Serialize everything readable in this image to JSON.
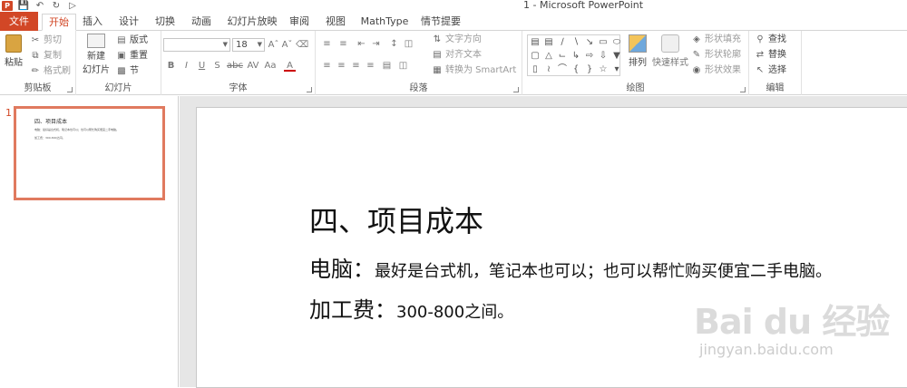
{
  "window_title": "1 - Microsoft PowerPoint",
  "qat": [
    "ppt-logo-icon",
    "save-icon",
    "undo-icon",
    "redo-icon",
    "start-presentation-icon"
  ],
  "tabs": [
    {
      "label": "文件"
    },
    {
      "label": "开始"
    },
    {
      "label": "插入"
    },
    {
      "label": "设计"
    },
    {
      "label": "切换"
    },
    {
      "label": "动画"
    },
    {
      "label": "幻灯片放映"
    },
    {
      "label": "审阅"
    },
    {
      "label": "视图"
    },
    {
      "label": "MathType"
    },
    {
      "label": "情节提要"
    }
  ],
  "active_tab": "开始",
  "ribbon": {
    "clipboard": {
      "paste": "粘贴",
      "cut": "剪切",
      "copy": "复制",
      "format_painter": "格式刷",
      "label": "剪贴板"
    },
    "slides": {
      "new_slide": "新建",
      "new_slide_2": "幻灯片",
      "layout": "版式",
      "reset": "重置",
      "section": "节",
      "label": "幻灯片"
    },
    "font": {
      "font_name": "",
      "font_size": "18",
      "label": "字体",
      "buttons": [
        "B",
        "I",
        "U",
        "S",
        "abc",
        "AV",
        "Aa",
        "A"
      ]
    },
    "paragraph": {
      "text_direction": "文字方向",
      "align_text": "对齐文本",
      "smartart": "转换为 SmartArt",
      "label": "段落"
    },
    "drawing": {
      "arrange": "排列",
      "quick_styles": "快速样式",
      "shape_fill": "形状填充",
      "shape_outline": "形状轮廓",
      "shape_effects": "形状效果",
      "label": "绘图"
    },
    "editing": {
      "find": "查找",
      "replace": "替换",
      "select": "选择",
      "label": "编辑"
    }
  },
  "thumbnail": {
    "number": "1",
    "lines": [
      "四、项目成本",
      "电脑：最好是台式机，笔记本也可以；也可以帮忙购买便宜二手电脑。",
      "加工费：300-800之间。"
    ]
  },
  "slide": {
    "title": "四、项目成本",
    "items": [
      {
        "key": "电脑：",
        "value": "最好是台式机，笔记本也可以；也可以帮忙购买便宜二手电脑。"
      },
      {
        "key": "加工费：",
        "value": "300-800之间。"
      }
    ]
  },
  "watermark": {
    "main": "Bai du 经验",
    "sub": "jingyan.baidu.com"
  },
  "colors": {
    "accent": "#d24726",
    "thumb_border": "#e07a5f"
  }
}
